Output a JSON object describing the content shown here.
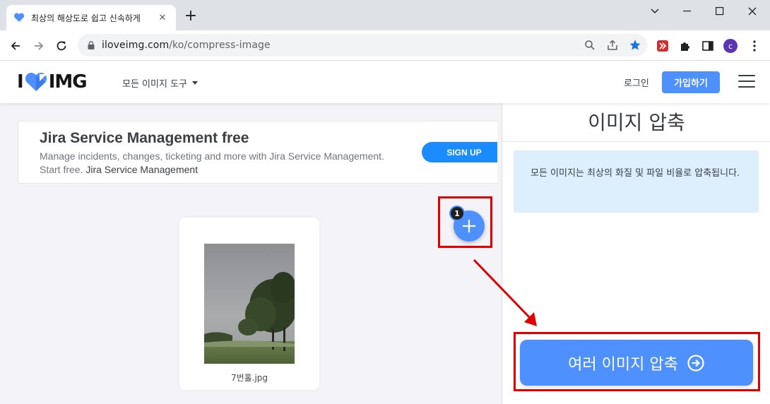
{
  "browser": {
    "tab_title": "최상의 해상도로 쉽고 신속하게",
    "url_domain": "iloveimg.com",
    "url_path": "/ko/compress-image",
    "profile_initial": "c"
  },
  "header": {
    "logo_prefix": "I",
    "logo_suffix": "IMG",
    "tools_menu_label": "모든 이미지 도구",
    "login_label": "로그인",
    "signup_label": "가입하기"
  },
  "ad": {
    "title": "Jira Service Management free",
    "description": "Manage incidents, changes, ticketing and more with Jira Service Management. Start free.",
    "brand": "Jira Service Management",
    "cta": "SIGN UP"
  },
  "files": [
    {
      "name": "7번홀.jpg"
    }
  ],
  "add_button": {
    "count": "1"
  },
  "sidebar": {
    "title": "이미지 압축",
    "info": "모든 이미지는 최상의 화질 및 파일 비율로 압축됩니다.",
    "action_label": "여러 이미지 압축"
  },
  "colors": {
    "accent": "#4d90fe",
    "annotation": "#e00000",
    "info_bg": "#ddeffc"
  }
}
